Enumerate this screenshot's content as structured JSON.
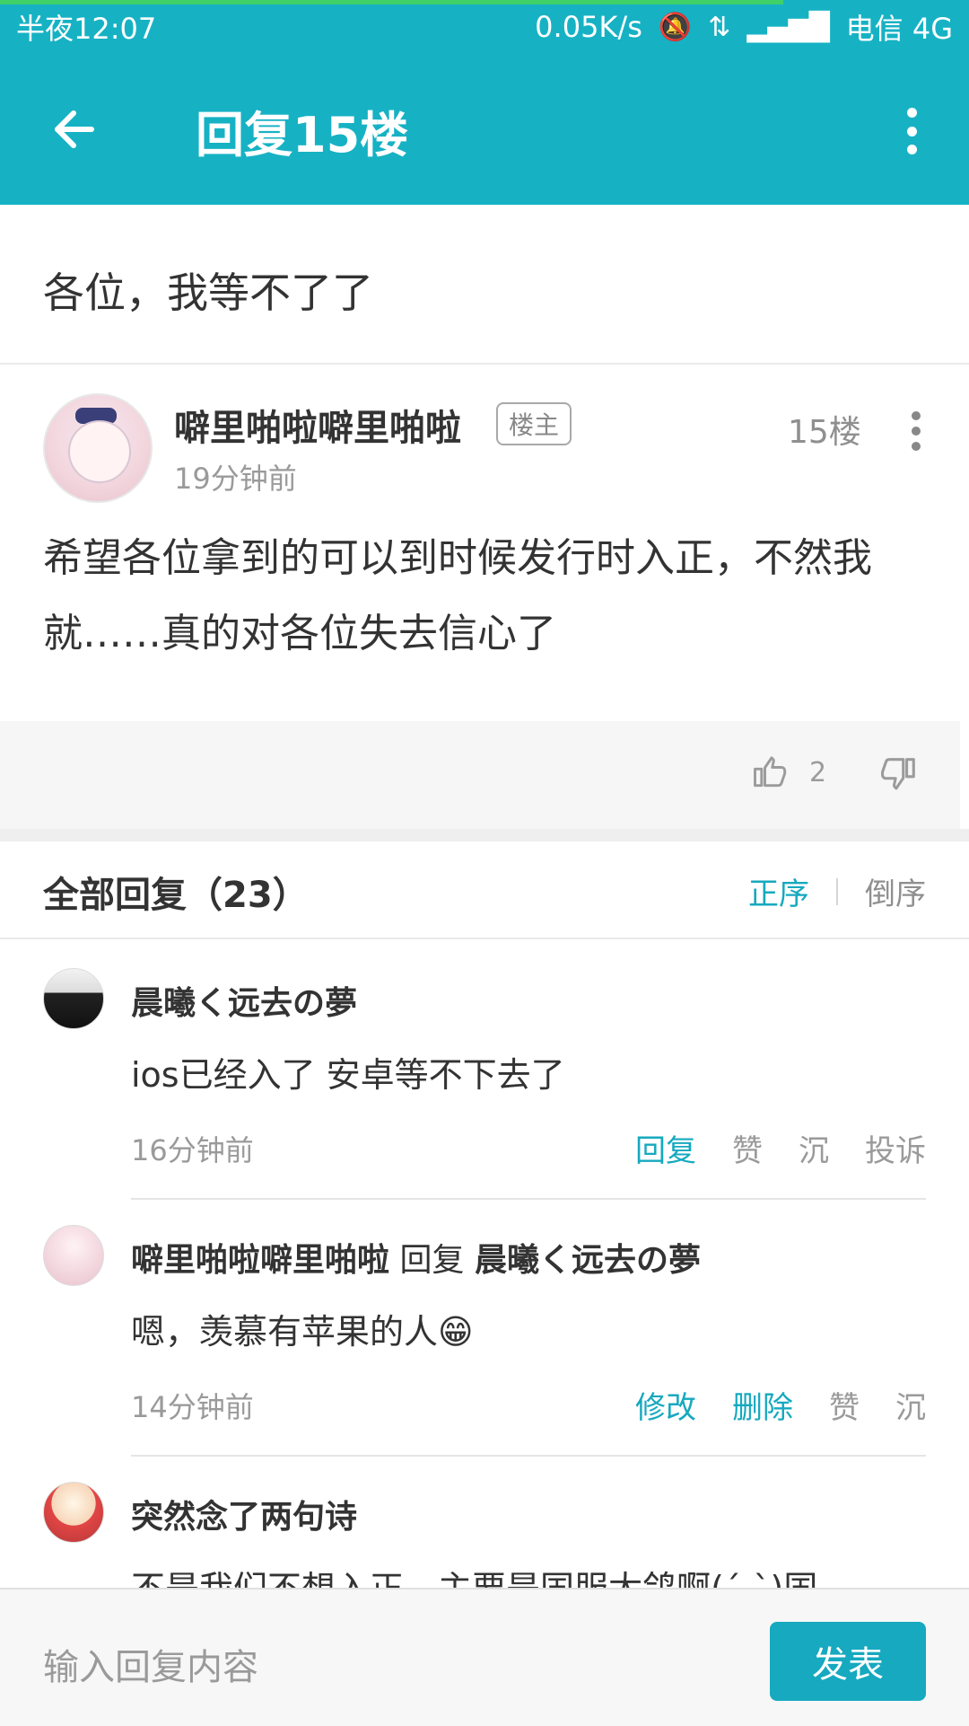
{
  "status": {
    "time": "半夜12:07",
    "net_speed": "0.05K/s",
    "carrier": "电信 4G"
  },
  "appbar": {
    "title": "回复15楼"
  },
  "thread": {
    "title": "各位，我等不了了"
  },
  "post": {
    "author": "噼里啪啦噼里啪啦",
    "tag": "楼主",
    "floor": "15楼",
    "time": "19分钟前",
    "content": "希望各位拿到的可以到时候发行时入正，不然我就……真的对各位失去信心了",
    "likes": "2"
  },
  "replies_section": {
    "header": "全部回复（23）",
    "sort_active": "正序",
    "sort_inactive": "倒序"
  },
  "replies": [
    {
      "name": "晨曦く远去の夢",
      "text": "ios已经入了 安卓等不下去了",
      "time": "16分钟前",
      "actions": [
        "回复",
        "赞",
        "沉",
        "投诉"
      ]
    },
    {
      "name": "噼里啪啦噼里啪啦",
      "reply_label": "回复",
      "reply_to": "晨曦く远去の夢",
      "text": "嗯，羡慕有苹果的人😁",
      "time": "14分钟前",
      "actions": [
        "修改",
        "删除",
        "赞",
        "沉"
      ]
    },
    {
      "name": "突然念了两句诗",
      "text": "不是我们不想入正，主要是国服太鸽啊(´-`)国"
    }
  ],
  "composer": {
    "placeholder": "输入回复内容",
    "send": "发表"
  },
  "colors": {
    "primary": "#16b2c4",
    "accent": "#16a9bf",
    "progress": "#3fd06a"
  }
}
